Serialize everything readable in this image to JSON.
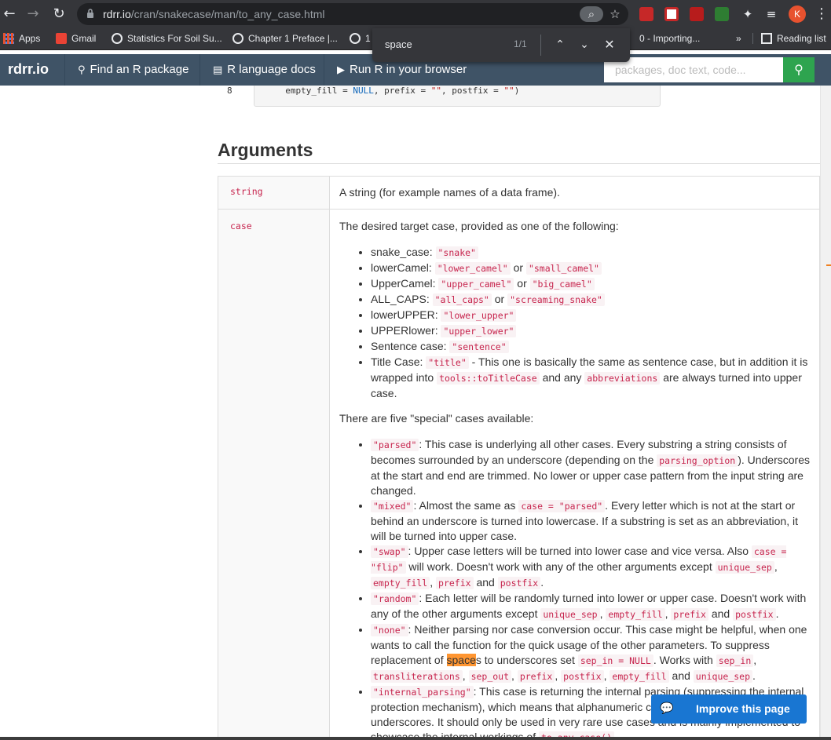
{
  "browser": {
    "url_host": "rdrr.io",
    "url_path": "/cran/snakecase/man/to_any_case.html",
    "avatar_letter": "K",
    "bookmarks": [
      {
        "label": "Apps"
      },
      {
        "label": "Gmail"
      },
      {
        "label": "Statistics For Soil Su..."
      },
      {
        "label": "Chapter 1 Preface |..."
      },
      {
        "label": "1"
      },
      {
        "label": "0 - Importing..."
      }
    ],
    "bookmarks_overflow": "»",
    "reading_list": "Reading list"
  },
  "find": {
    "query": "space",
    "count": "1/1"
  },
  "site": {
    "brand": "rdrr.io",
    "nav": [
      "Find an R package",
      "R language docs",
      "Run R in your browser"
    ],
    "search_placeholder": "packages, doc text, code..."
  },
  "code": {
    "line_no": "8",
    "pre": "  empty_fill = ",
    "kw": "NULL",
    "mid": ", prefix = ",
    "s1": "\"\"",
    "mid2": ", postfix = ",
    "s2": "\"\"",
    "end": ")"
  },
  "arguments": {
    "heading": "Arguments",
    "string_name": "string",
    "string_desc": "A string (for example names of a data frame).",
    "case_name": "case",
    "case_intro": "The desired target case, provided as one of the following:",
    "special_intro": "There are five \"special\" cases available:"
  },
  "improve_label": "Improve this page"
}
